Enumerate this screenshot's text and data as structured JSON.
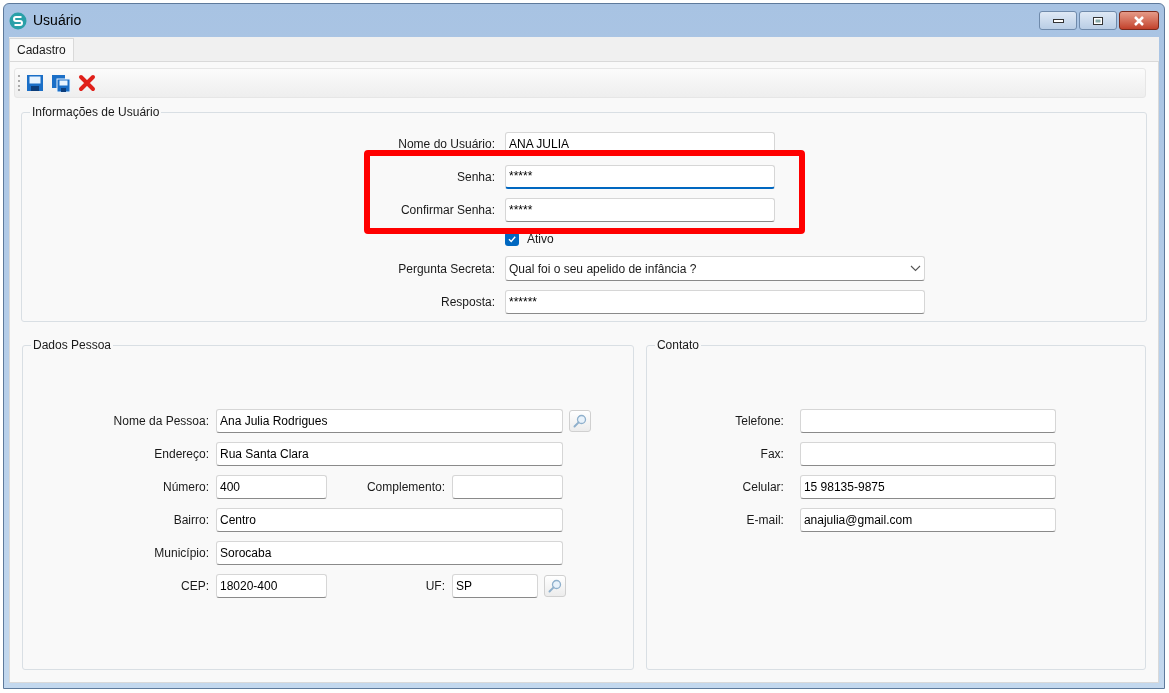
{
  "window": {
    "title": "Usuário"
  },
  "tabs": [
    {
      "label": "Cadastro",
      "selected": true
    }
  ],
  "user_info": {
    "title": "Informações de Usuário",
    "fields": [
      {
        "kind": "text",
        "label": "Nome do Usuário:",
        "value": "ANA JULIA",
        "focused": false,
        "highlighted": false
      },
      {
        "kind": "text",
        "label": "Senha:",
        "value": "*****",
        "focused": true,
        "highlighted": true
      },
      {
        "kind": "text",
        "label": "Confirmar Senha:",
        "value": "*****",
        "focused": false,
        "highlighted": true
      },
      {
        "kind": "checkbox",
        "label": "Ativo",
        "checked": true,
        "highlighted": false
      },
      {
        "kind": "select",
        "label": "Pergunta Secreta:",
        "value": "Qual foi o seu apelido de infância ?",
        "highlighted": false
      },
      {
        "kind": "wide",
        "label": "Resposta:",
        "value": "******",
        "focused": false,
        "highlighted": false
      }
    ]
  },
  "person": {
    "title": "Dados Pessoa",
    "rows": [
      {
        "kind": "full",
        "label": "Nome da Pessoa:",
        "value": "Ana Julia Rodrigues",
        "lookup": true
      },
      {
        "kind": "full",
        "label": "Endereço:",
        "value": "Rua Santa Clara",
        "lookup": false
      },
      {
        "kind": "pair",
        "label": "Número:",
        "value": "400",
        "label_2": "Complemento:",
        "lookup": false
      },
      {
        "kind": "full",
        "label": "Bairro:",
        "value": "Centro",
        "lookup": false
      },
      {
        "kind": "full",
        "label": "Município:",
        "value": "Sorocaba",
        "lookup": false
      },
      {
        "kind": "pair",
        "label": "CEP:",
        "value": "18020-400",
        "label_2": "UF:",
        "value_2": "SP",
        "lookup": true
      }
    ]
  },
  "contact": {
    "title": "Contato",
    "fields": [
      {
        "label": "Telefone:"
      },
      {
        "label": "Fax:"
      },
      {
        "label": "Celular:",
        "value": "15 98135-9875"
      },
      {
        "label": "E-mail:",
        "value": "anajulia@gmail.com"
      }
    ]
  }
}
